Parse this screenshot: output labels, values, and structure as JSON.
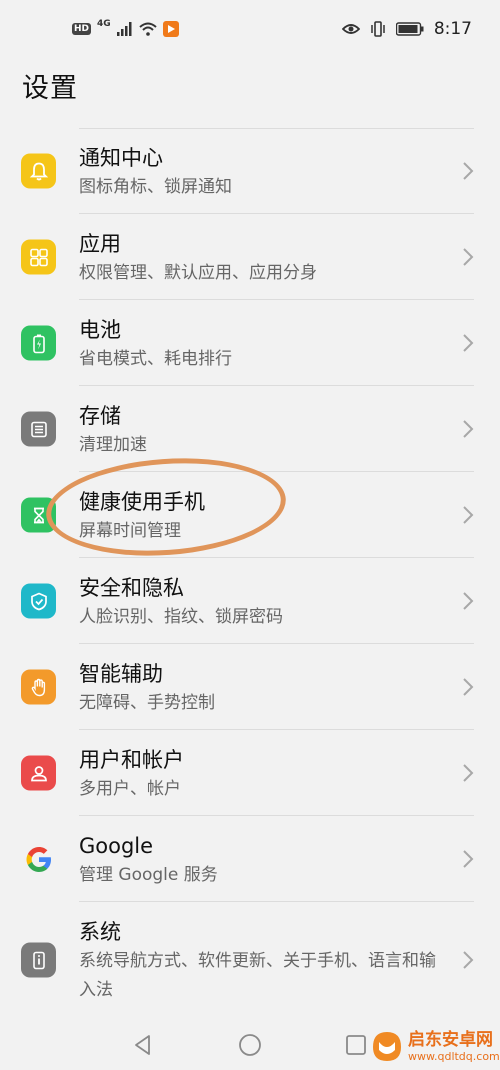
{
  "status_bar": {
    "time": "8:17",
    "hd": "HD",
    "network": "4G"
  },
  "header": {
    "title": "设置"
  },
  "settings": [
    {
      "title": "通知中心",
      "subtitle": "图标角标、锁屏通知",
      "icon": "bell-icon",
      "color": "#f5c518"
    },
    {
      "title": "应用",
      "subtitle": "权限管理、默认应用、应用分身",
      "icon": "apps-grid-icon",
      "color": "#f5c518"
    },
    {
      "title": "电池",
      "subtitle": "省电模式、耗电排行",
      "icon": "battery-icon",
      "color": "#2fc262"
    },
    {
      "title": "存储",
      "subtitle": "清理加速",
      "icon": "storage-icon",
      "color": "#7a7a7a"
    },
    {
      "title": "健康使用手机",
      "subtitle": "屏幕时间管理",
      "icon": "hourglass-icon",
      "color": "#2fc262"
    },
    {
      "title": "安全和隐私",
      "subtitle": "人脸识别、指纹、锁屏密码",
      "icon": "shield-icon",
      "color": "#1fb8c9"
    },
    {
      "title": "智能辅助",
      "subtitle": "无障碍、手势控制",
      "icon": "hand-icon",
      "color": "#f39a2b"
    },
    {
      "title": "用户和帐户",
      "subtitle": "多用户、帐户",
      "icon": "user-icon",
      "color": "#ea4b4b"
    },
    {
      "title": "Google",
      "subtitle": "管理 Google 服务",
      "icon": "google-icon",
      "color": "#ffffff"
    },
    {
      "title": "系统",
      "subtitle": "系统导航方式、软件更新、关于手机、语言和输入法",
      "icon": "phone-info-icon",
      "color": "#7a7a7a"
    }
  ],
  "watermark": {
    "line1": "启东安卓网",
    "line2": "www.qdltdq.com"
  }
}
